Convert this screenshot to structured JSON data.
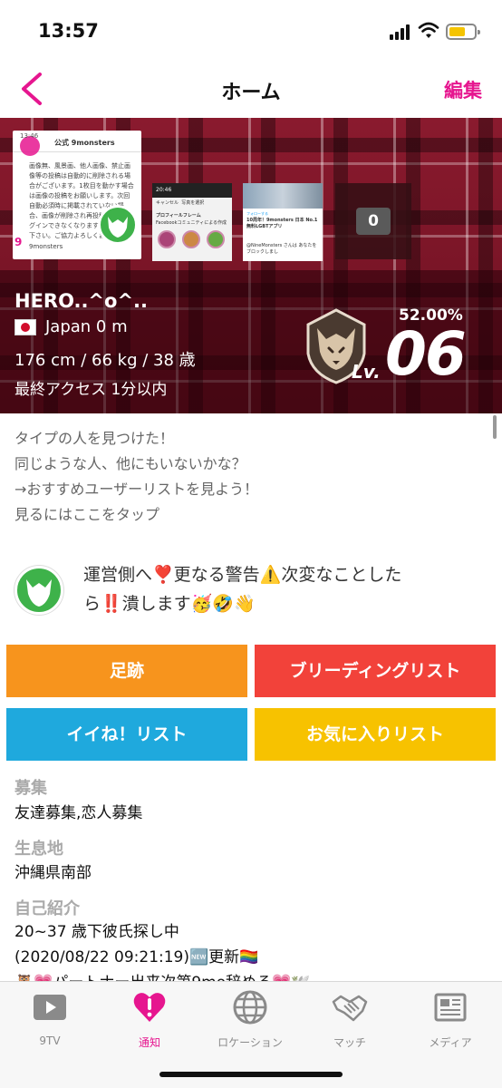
{
  "status_bar": {
    "time": "13:57"
  },
  "nav": {
    "title": "ホーム",
    "edit_label": "編集"
  },
  "header": {
    "thumb_main": {
      "time": "13:46",
      "title": "公式 9monsters",
      "body": "画像無、風景画、他人画像、禁止画像等の投稿は自動的に削除される場合がございます。1枚目を動かす場合は画像の投稿をお願いします。次回自動必須時に掲載されていない場合、画像が削除され再投稿ないとログインできなくなりますのでご注意下さい。ご協力よろしくお願い致します。",
      "logo": "9",
      "brand": "9monsters"
    },
    "thumb2": {
      "time": "20:46",
      "cancel": "キャンセル",
      "title": "写真を選択",
      "frame_title": "プロフィールフレーム",
      "frame_desc": "Facebookコミュニティによる作成"
    },
    "thumb3": {
      "follow": "フォローする",
      "headline": "10周年！9monsters 日本 No.1 無料LGBTアプリ",
      "blocked": "@NineMonsters さんは あなたをブロックしまし"
    },
    "photo_count": "0",
    "username": "HERO..^o^..",
    "location": "Japan  0 m",
    "stats": "176 cm / 66 kg / 38 歳",
    "last_access": "最終アクセス 1分以内",
    "level_percent": "52.00%",
    "level_prefix": "Lv.",
    "level": "06"
  },
  "recommend_text": "タイプの人を見つけた！\n同じような人、他にもいないかな？\n→おすすめユーザーリストを見よう！\n見るにはここをタップ",
  "status_post": "運営側へ❣️更なる警告⚠️次変なことした\nら‼️潰します🥳🤣👋",
  "buttons": {
    "footprint": "足跡",
    "breeding": "ブリーディングリスト",
    "likes": "イイね！リスト",
    "favorites": "お気に入りリスト"
  },
  "profile": {
    "recruit_label": "募集",
    "recruit_value": "友達募集,恋人募集",
    "habitat_label": "生息地",
    "habitat_value": "沖縄県南部",
    "intro_label": "自己紹介",
    "intro_value": "20~37 歳下彼氏探し中\n(2020/08/22 09:21:19)🆕更新🏳️‍🌈\n🦉💗パートナー出来次第9mo辞める💗🕊️"
  },
  "tabs": [
    {
      "label": "9TV",
      "icon": "play-icon"
    },
    {
      "label": "通知",
      "icon": "notification-heart-icon",
      "active": true
    },
    {
      "label": "ロケーション",
      "icon": "globe-icon"
    },
    {
      "label": "マッチ",
      "icon": "handshake-icon"
    },
    {
      "label": "メディア",
      "icon": "newspaper-icon"
    }
  ],
  "colors": {
    "accent": "#e6168f",
    "footprint": "#f7941d",
    "breeding": "#f2423a",
    "likes": "#1fa9dd",
    "favorites": "#f7c200",
    "badge_green": "#3eb24a"
  }
}
